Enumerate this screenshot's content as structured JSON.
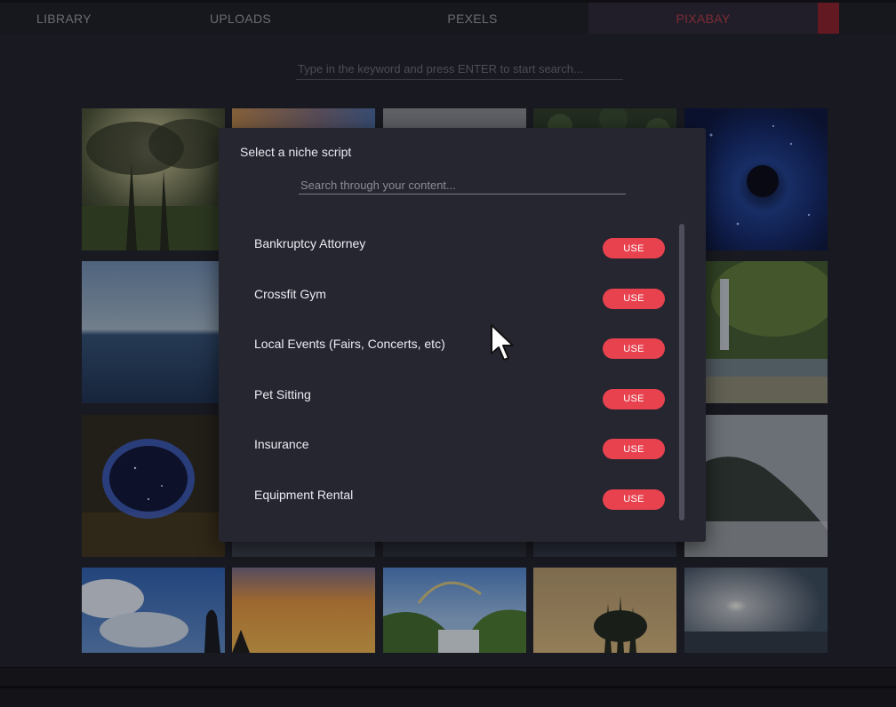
{
  "tabs": [
    {
      "label": "LIBRARY",
      "active": false
    },
    {
      "label": "UPLOADS",
      "active": false
    },
    {
      "label": "PEXELS",
      "active": false
    },
    {
      "label": "PIXABAY",
      "active": true
    }
  ],
  "search": {
    "placeholder": "Type in the keyword and press ENTER to start search..."
  },
  "gallery": {
    "images": [
      "misty-forest-sunrise",
      "sunset-clouds",
      "cloudy-sky",
      "green-foliage",
      "blue-eye-space",
      "ocean-horizon",
      "waterfall-forest",
      "cosmic-hole",
      "misty-mountain",
      "clouds-silhouette",
      "orange-sunset-sky",
      "rainbow-waterfall",
      "trees-sunrise",
      "sun-over-fog"
    ]
  },
  "modal": {
    "title": "Select a niche script",
    "search_placeholder": "Search through your content...",
    "items": [
      {
        "label": "Bankruptcy Attorney",
        "button": "USE"
      },
      {
        "label": "Crossfit Gym",
        "button": "USE"
      },
      {
        "label": "Local Events (Fairs, Concerts, etc)",
        "button": "USE"
      },
      {
        "label": "Pet Sitting",
        "button": "USE"
      },
      {
        "label": "Insurance",
        "button": "USE"
      },
      {
        "label": "Equipment Rental",
        "button": "USE"
      }
    ]
  },
  "colors": {
    "accent": "#e8424f",
    "active_tab_text": "#b23a44",
    "modal_bg": "#262631"
  }
}
